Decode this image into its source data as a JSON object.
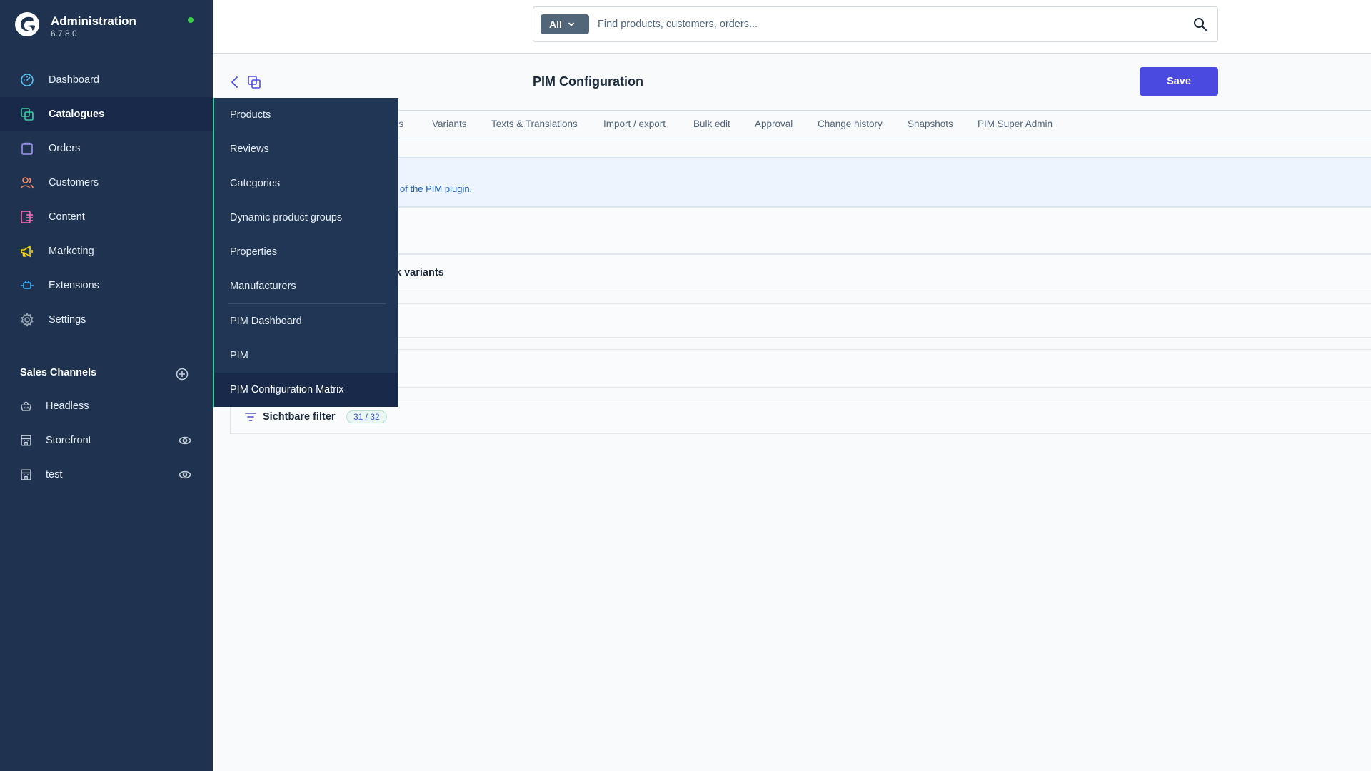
{
  "brand": {
    "title": "Administration",
    "version": "6.7.8.0"
  },
  "nav": {
    "items": [
      {
        "label": "Dashboard",
        "icon": "dashboard-icon"
      },
      {
        "label": "Catalogues",
        "icon": "catalogues-icon",
        "active": true
      },
      {
        "label": "Orders",
        "icon": "orders-icon"
      },
      {
        "label": "Customers",
        "icon": "customers-icon"
      },
      {
        "label": "Content",
        "icon": "content-icon"
      },
      {
        "label": "Marketing",
        "icon": "marketing-icon"
      },
      {
        "label": "Extensions",
        "icon": "extensions-icon"
      },
      {
        "label": "Settings",
        "icon": "settings-icon"
      }
    ]
  },
  "sales_channels": {
    "title": "Sales Channels",
    "items": [
      {
        "label": "Headless",
        "icon": "basket-icon"
      },
      {
        "label": "Storefront",
        "icon": "storefront-icon"
      },
      {
        "label": "test",
        "icon": "storefront-icon"
      }
    ]
  },
  "search": {
    "type_label": "All",
    "placeholder": "Find products, customers, orders..."
  },
  "page": {
    "title": "PIM Configuration",
    "save_label": "Save"
  },
  "tabs": [
    {
      "label": "cts"
    },
    {
      "label": "Variants"
    },
    {
      "label": "Texts & Translations"
    },
    {
      "label": "Import / export"
    },
    {
      "label": "Bulk edit"
    },
    {
      "label": "Approval"
    },
    {
      "label": "Change history"
    },
    {
      "label": "Snapshots"
    },
    {
      "label": "PIM Super Admin"
    }
  ],
  "content": {
    "info_text": "of the PIM plugin.",
    "row_variants_label": "k variants",
    "filter_label": "Sichtbare filter",
    "filter_badge": "31 / 32"
  },
  "flyout": {
    "items": [
      {
        "label": "Products"
      },
      {
        "label": "Reviews"
      },
      {
        "label": "Categories"
      },
      {
        "label": "Dynamic product groups"
      },
      {
        "label": "Properties"
      },
      {
        "label": "Manufacturers"
      },
      {
        "label": "PIM Dashboard"
      },
      {
        "label": "PIM"
      },
      {
        "label": "PIM Configuration Matrix",
        "active": true
      }
    ]
  },
  "colors": {
    "sidebar_bg": "#1f3350",
    "primary": "#4a4ae0",
    "status_online": "#37d046",
    "flyout_accent": "#37d0a0"
  }
}
